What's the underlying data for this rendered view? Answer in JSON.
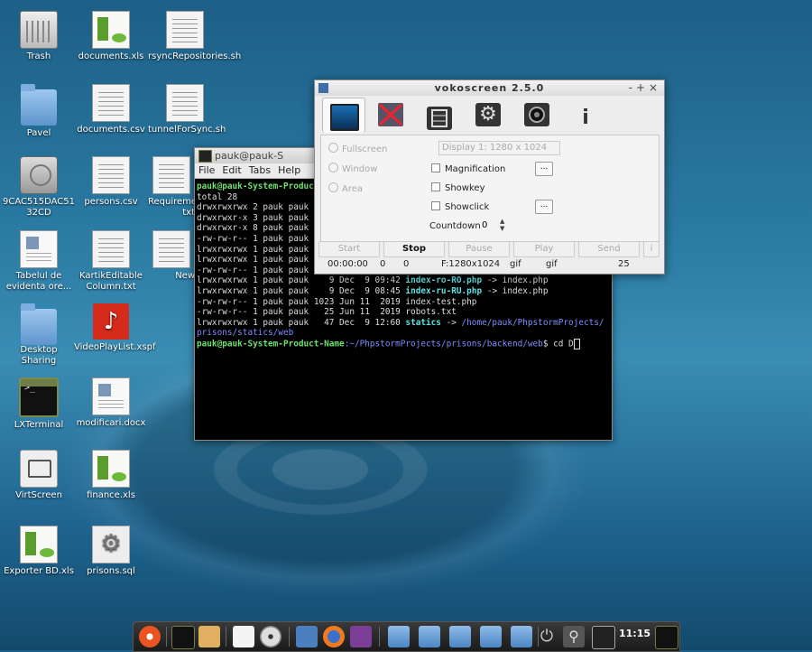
{
  "desktop_icons": [
    {
      "label": "Trash",
      "icon": "trash-icon"
    },
    {
      "label": "documents.xls",
      "icon": "spreadsheet-icon"
    },
    {
      "label": "rsyncRepositories.sh",
      "icon": "text-file-icon"
    },
    {
      "label": "Pavel",
      "icon": "folder-icon"
    },
    {
      "label": "documents.csv",
      "icon": "text-file-icon"
    },
    {
      "label": "tunnelForSync.sh",
      "icon": "text-file-icon"
    },
    {
      "label": "9CAC515DAC5132CD",
      "icon": "drive-icon"
    },
    {
      "label": "persons.csv",
      "icon": "text-file-icon"
    },
    {
      "label": "Requireme txt",
      "icon": "text-file-icon"
    },
    {
      "label": "Tabelul de evidenta ore...",
      "icon": "document-icon"
    },
    {
      "label": "KartikEditable Column.txt",
      "icon": "text-file-icon"
    },
    {
      "label": "New",
      "icon": "text-file-icon"
    },
    {
      "label": "Desktop Sharing",
      "icon": "folder-icon"
    },
    {
      "label": "VideoPlayList.xspf",
      "icon": "music-icon"
    },
    {
      "label": "LXTerminal",
      "icon": "terminal-icon"
    },
    {
      "label": "modificari.docx",
      "icon": "document-icon"
    },
    {
      "label": "VirtScreen",
      "icon": "screen-icon"
    },
    {
      "label": "finance.xls",
      "icon": "spreadsheet-icon"
    },
    {
      "label": "Exporter BD.xls",
      "icon": "spreadsheet-icon"
    },
    {
      "label": "prisons.sql",
      "icon": "gear-icon"
    }
  ],
  "terminal": {
    "title": "pauk@pauk-S",
    "menu": [
      "File",
      "Edit",
      "Tabs",
      "Help"
    ],
    "prompt_line": "pauk@pauk-System-Product",
    "lines": [
      "total 28",
      "drwxrwxrwx 2 pauk pauk",
      "drwxrwxr-x 3 pauk pauk",
      "drwxrwxr-x 8 pauk pauk",
      "-rw-rw-r-- 1 pauk pauk",
      "lrwxrwxrwx 1 pauk pauk",
      "lrwxrwxrwx 1 pauk pauk",
      "-rw-rw-r-- 1 pauk pauk  644 Oct 21 11:07 index.php"
    ],
    "link1_meta": "lrwxrwxrwx 1 pauk pauk    9 Dec  9 09:42 ",
    "link1_name": "index-ro-RO.php",
    "link1_target": " -> index.php",
    "link2_meta": "lrwxrwxrwx 1 pauk pauk    9 Dec  9 08:45 ",
    "link2_name": "index-ru-RU.php",
    "link2_target": " -> index.php",
    "line_test": "-rw-rw-r-- 1 pauk pauk 1023 Jun 11  2019 index-test.php",
    "line_robots": "-rw-rw-r-- 1 pauk pauk   25 Jun 11  2019 robots.txt",
    "link3_meta": "lrwxrwxrwx 1 pauk pauk   47 Dec  9 12:60 ",
    "link3_name": "statics",
    "link3_target_a": " -> ",
    "link3_target_b": "/home/pauk/PhpstormProjects/",
    "link3_target_c": "prisons/statics/web",
    "final_prompt_user": "pauk@pauk-System-Product-Name",
    "final_prompt_path": ":~/PhpstormProjects/prisons/backend/web",
    "final_command": "$ cd D"
  },
  "vokoscreen": {
    "title": "vokoscreen 2.5.0",
    "window_buttons": [
      "-",
      "+",
      "×"
    ],
    "tabs": [
      "screen-tab",
      "camera-off-tab",
      "video-settings-tab",
      "settings-tab",
      "webcam-tab",
      "info-tab"
    ],
    "fullscreen_label": "Fullscreen",
    "window_label": "Window",
    "area_label": "Area",
    "display_combo": "Display 1: 1280 x 1024",
    "magnification_label": "Magnification",
    "showkey_label": "Showkey",
    "showclick_label": "Showclick",
    "dots_label": "...",
    "countdown_label": "Countdown",
    "countdown_value": "0",
    "buttons": {
      "start": "Start",
      "stop": "Stop",
      "pause": "Pause",
      "play": "Play",
      "send": "Send",
      "info": "i"
    },
    "status": {
      "time": "00:00:00",
      "a": "0",
      "b": "0",
      "frame": "F:1280x1024",
      "fmt1": "gif",
      "fmt2": "gif",
      "fps": "25"
    }
  },
  "taskbar": {
    "clock": "11:15"
  }
}
